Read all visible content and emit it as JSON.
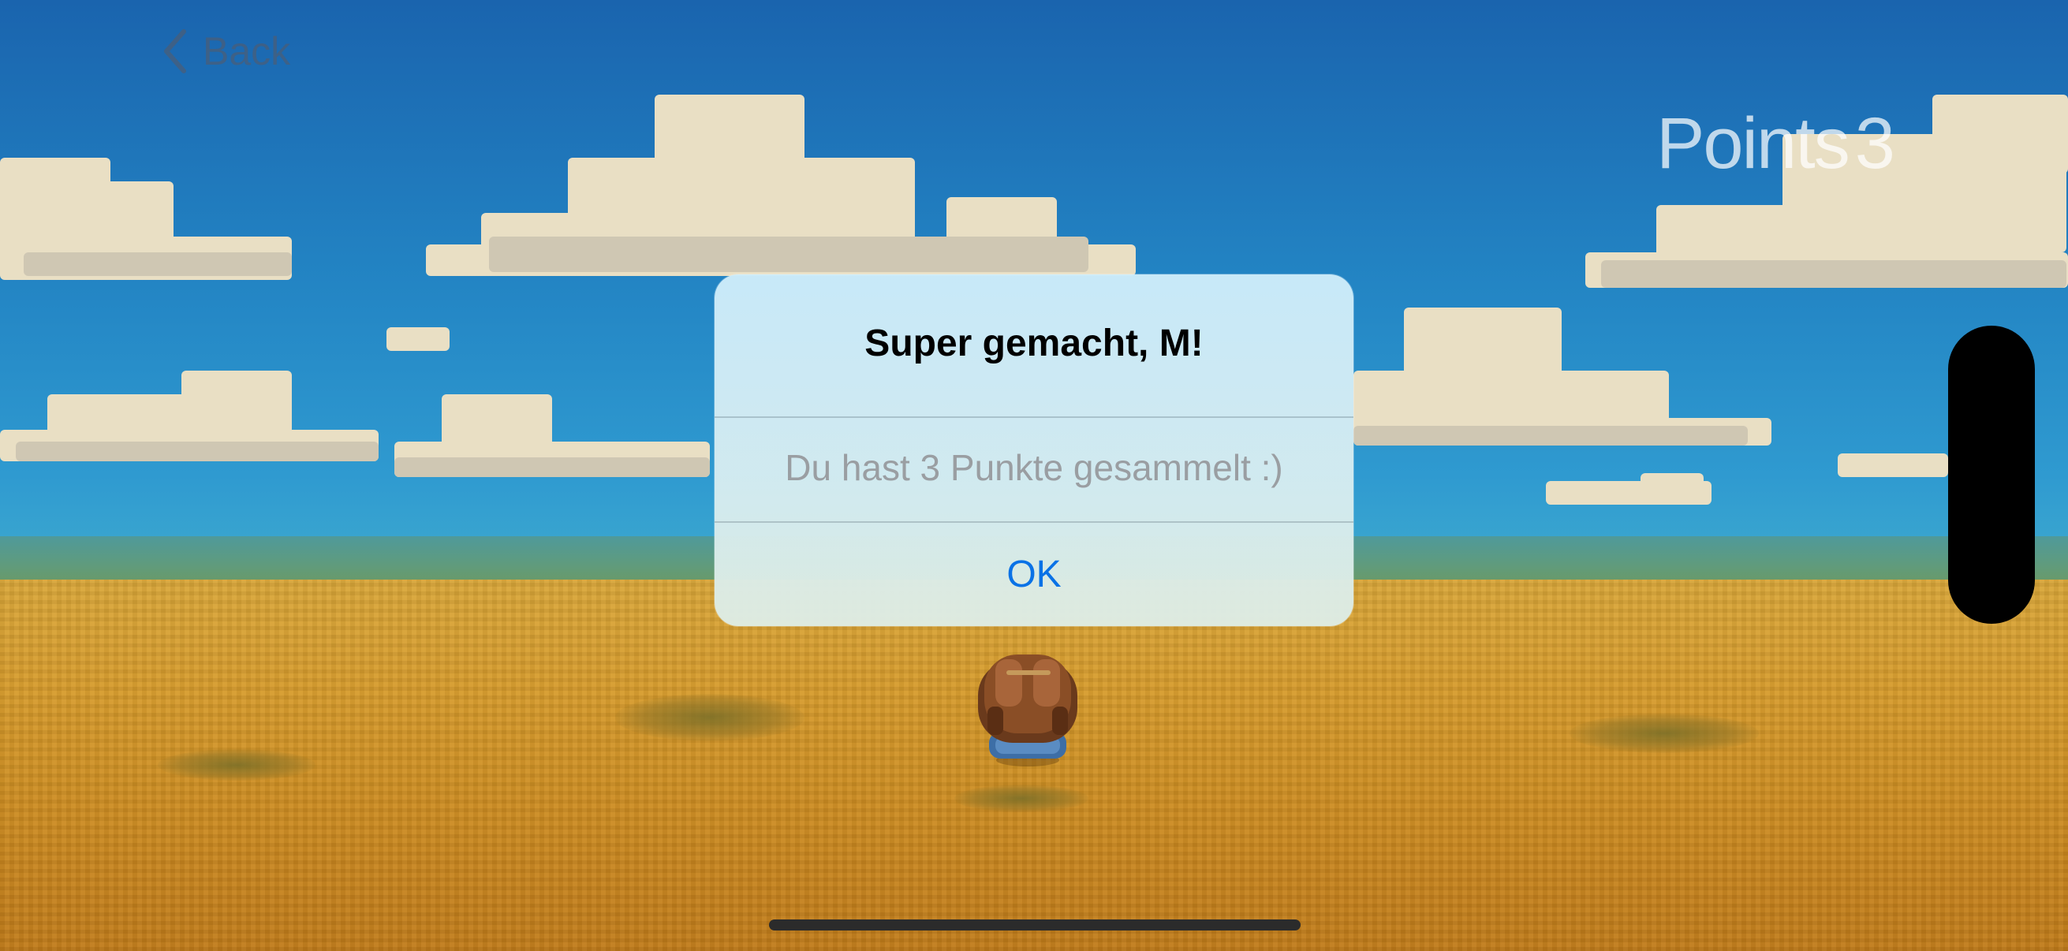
{
  "nav": {
    "back_label": "Back",
    "back_icon": "chevron-left-icon"
  },
  "hud": {
    "points_label": "Points",
    "points_value": "3"
  },
  "alert": {
    "title": "Super gemacht, M!",
    "message": "Du hast 3 Punkte gesammelt :)",
    "ok_label": "OK"
  },
  "colors": {
    "sky_top": "#1a64ae",
    "sky_bottom": "#3aa6cf",
    "field": "#d69b2c",
    "accent": "#0a72e6",
    "message_text": "#9a9ea2",
    "cloud": "#e9dfc4"
  }
}
